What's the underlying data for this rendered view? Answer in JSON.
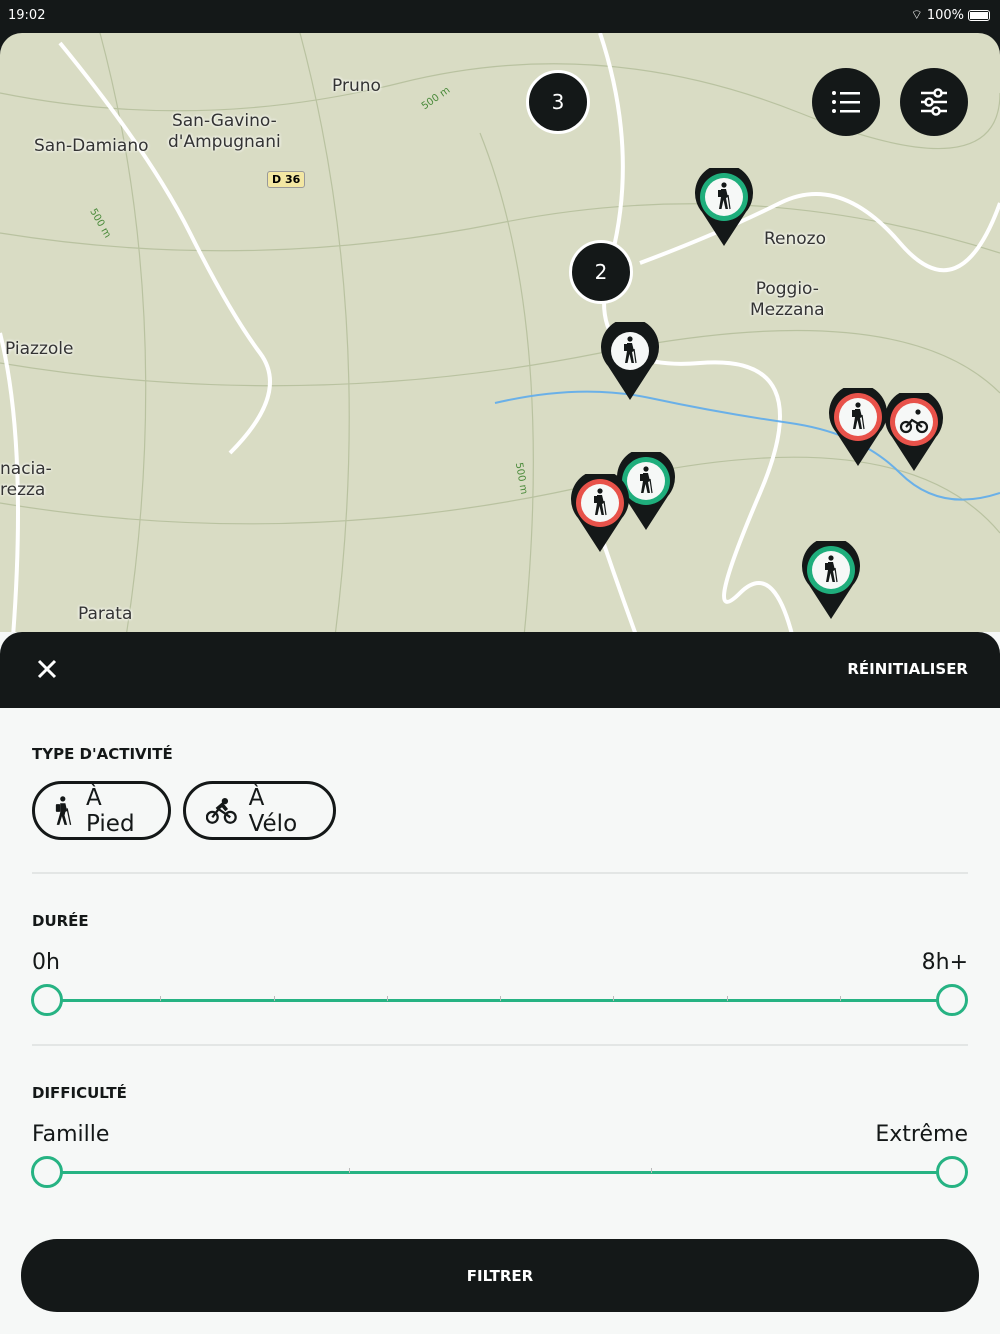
{
  "status": {
    "time": "19:02",
    "battery": "100%"
  },
  "map": {
    "places": [
      "Pruno",
      "San-Gavino-\nd'Ampugnani",
      "San-Damiano",
      "Renozo",
      "Poggio-\nMezzana",
      "Piazzole",
      "nacia-\nrezza",
      "Parata"
    ],
    "road": "D 36",
    "elevation": "500 m",
    "clusters": [
      "3",
      "2"
    ],
    "markers": [
      {
        "activity": "walk",
        "status": "green"
      },
      {
        "activity": "walk",
        "status": "black"
      },
      {
        "activity": "walk",
        "status": "red"
      },
      {
        "activity": "bike",
        "status": "red"
      },
      {
        "activity": "walk",
        "status": "green"
      },
      {
        "activity": "walk",
        "status": "red"
      },
      {
        "activity": "walk",
        "status": "green"
      }
    ]
  },
  "colors": {
    "accent": "#26b383",
    "green": "#1fae7c",
    "red": "#e8524a",
    "dark": "#141818"
  },
  "sheet": {
    "reset": "RÉINITIALISER",
    "activity_title": "TYPE D'ACTIVITÉ",
    "activities": [
      {
        "label": "À Pied",
        "icon": "hiker-icon"
      },
      {
        "label": "À Vélo",
        "icon": "bike-icon"
      }
    ],
    "duration_title": "DURÉE",
    "duration_min": "0h",
    "duration_max": "8h+",
    "duration_range": [
      0,
      1
    ],
    "difficulty_title": "DIFFICULTÉ",
    "difficulty_min": "Famille",
    "difficulty_max": "Extrême",
    "difficulty_range": [
      0,
      1
    ],
    "filter": "FILTRER"
  }
}
